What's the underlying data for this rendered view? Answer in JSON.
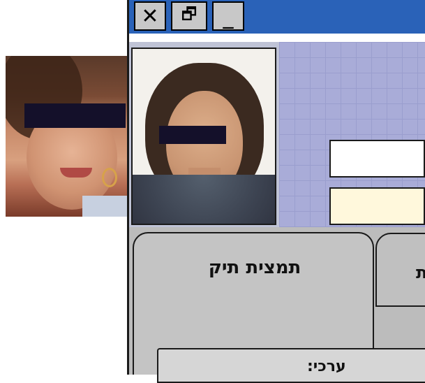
{
  "window": {
    "buttons": [
      {
        "name": "close",
        "glyph": "✕"
      },
      {
        "name": "restore",
        "glyph": "🗗"
      },
      {
        "name": "minimize",
        "glyph": "_"
      }
    ]
  },
  "tabs": {
    "active_label": "תמצית תיק",
    "inactive_label": "ת"
  },
  "bottom": {
    "label": "ערכי:"
  },
  "colors": {
    "title_bar": "#2a62b8",
    "grid_panel": "#a9acd8",
    "field_cream": "#fff8dc",
    "censor": "#14102a"
  }
}
